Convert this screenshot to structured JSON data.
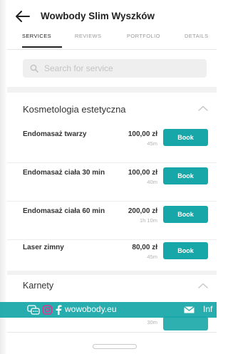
{
  "header": {
    "title": "Wowbody Slim Wyszków"
  },
  "tabs": [
    {
      "label": "SERVICES"
    },
    {
      "label": "REVIEWS"
    },
    {
      "label": "PORTFOLIO"
    },
    {
      "label": "DETAILS"
    }
  ],
  "search": {
    "placeholder": "Search for service"
  },
  "section": {
    "title": "Kosmetologia estetyczna",
    "services": [
      {
        "name": "Endomasaż twarzy",
        "price": "100,00 zł",
        "duration": "45m",
        "book_label": "Book"
      },
      {
        "name": "Endomasaż ciała 30 min",
        "price": "100,00 zł",
        "duration": "40m",
        "book_label": "Book"
      },
      {
        "name": "Endomasaż ciała 60 min",
        "price": "200,00 zł",
        "duration": "1h 10m",
        "book_label": "Book"
      },
      {
        "name": "Laser zimny",
        "price": "80,00 zł",
        "duration": "45m",
        "book_label": "Book"
      }
    ]
  },
  "section2": {
    "title": "Karnety",
    "partial_duration": "30m"
  },
  "overlay": {
    "website": "wowobody.eu",
    "info_label": "Inf"
  },
  "colors": {
    "accent": "#17a7a8",
    "text": "#333333",
    "muted": "#b3b3b3"
  }
}
